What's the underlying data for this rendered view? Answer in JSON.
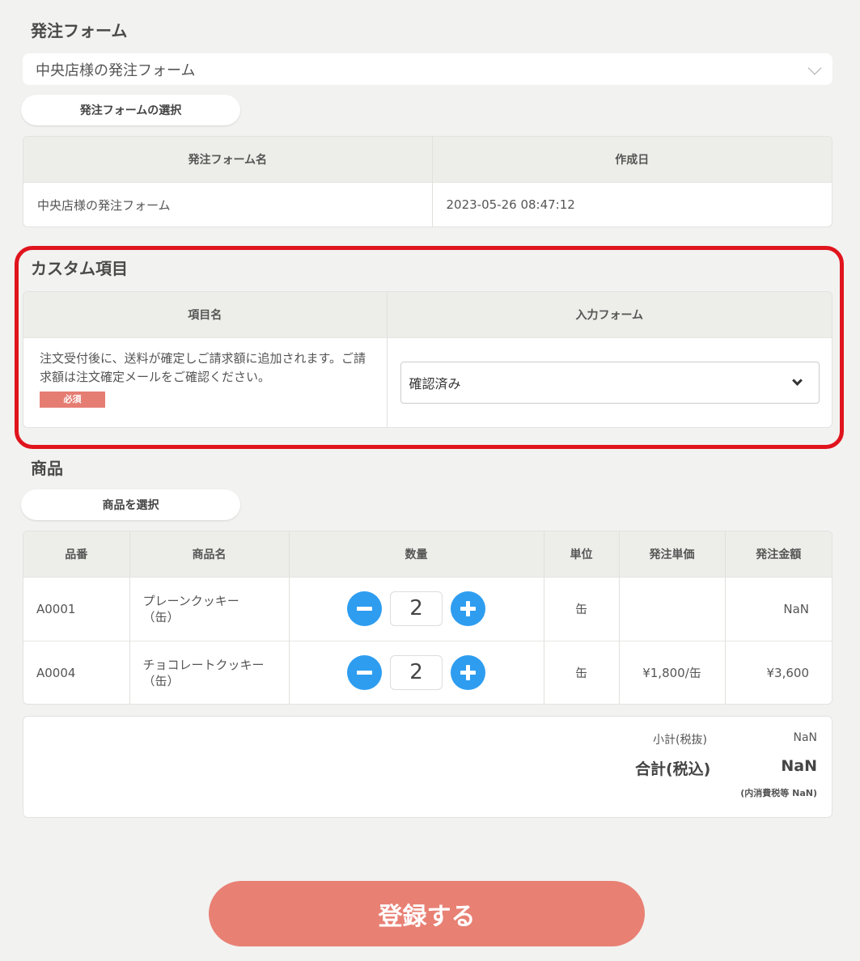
{
  "order_form": {
    "section_title": "発注フォーム",
    "selected_value": "中央店様の発注フォーム",
    "select_button": "発注フォームの選択",
    "table": {
      "headers": [
        "発注フォーム名",
        "作成日"
      ],
      "row": {
        "name": "中央店様の発注フォーム",
        "created": "2023-05-26 08:47:12"
      }
    }
  },
  "custom": {
    "section_title": "カスタム項目",
    "headers": [
      "項目名",
      "入力フォーム"
    ],
    "item_text": "注文受付後に、送料が確定しご請求額に追加されます。ご請求額は注文確定メールをご確認ください。",
    "required_badge": "必須",
    "select_value": "確認済み",
    "highlight_color": "#e0141d"
  },
  "products": {
    "section_title": "商品",
    "select_button": "商品を選択",
    "headers": [
      "品番",
      "商品名",
      "数量",
      "単位",
      "発注単価",
      "発注金額"
    ],
    "rows": [
      {
        "code": "A0001",
        "name": "プレーンクッキー",
        "name_sub": "（缶）",
        "qty": "2",
        "unit": "缶",
        "unit_price": "",
        "amount": "NaN"
      },
      {
        "code": "A0004",
        "name": "チョコレートクッキー",
        "name_sub": "（缶）",
        "qty": "2",
        "unit": "缶",
        "unit_price": "¥1,800/缶",
        "amount": "¥3,600"
      }
    ],
    "accent_color": "#2e9df0"
  },
  "totals": {
    "subtotal_label": "小計(税抜)",
    "subtotal_value": "NaN",
    "total_label": "合計(税込)",
    "total_value": "NaN",
    "tax_note": "(内消費税等 NaN)"
  },
  "submit_label": "登録する",
  "submit_color": "#e88074"
}
